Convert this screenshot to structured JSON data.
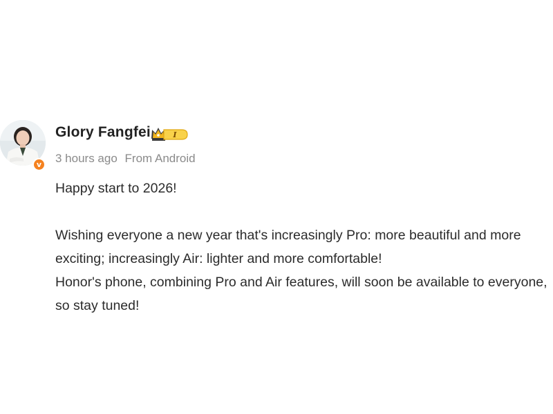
{
  "post": {
    "username": "Glory Fangfei",
    "level_badge": "I",
    "verified_icon": "v",
    "time": "3 hours ago",
    "source": "From Android",
    "lines": {
      "greeting": "Happy start to 2026!",
      "wish": "Wishing everyone a new year that's increasingly Pro: more beautiful and more exciting; increasingly Air: lighter and more comfortable!",
      "announcement": "Honor's phone, combining Pro and Air features, will soon be available to everyone, so stay tuned!"
    }
  },
  "colors": {
    "verified": "#f5821f",
    "badge_gold": "#f2b51d",
    "meta_text": "#8a8a8a"
  }
}
